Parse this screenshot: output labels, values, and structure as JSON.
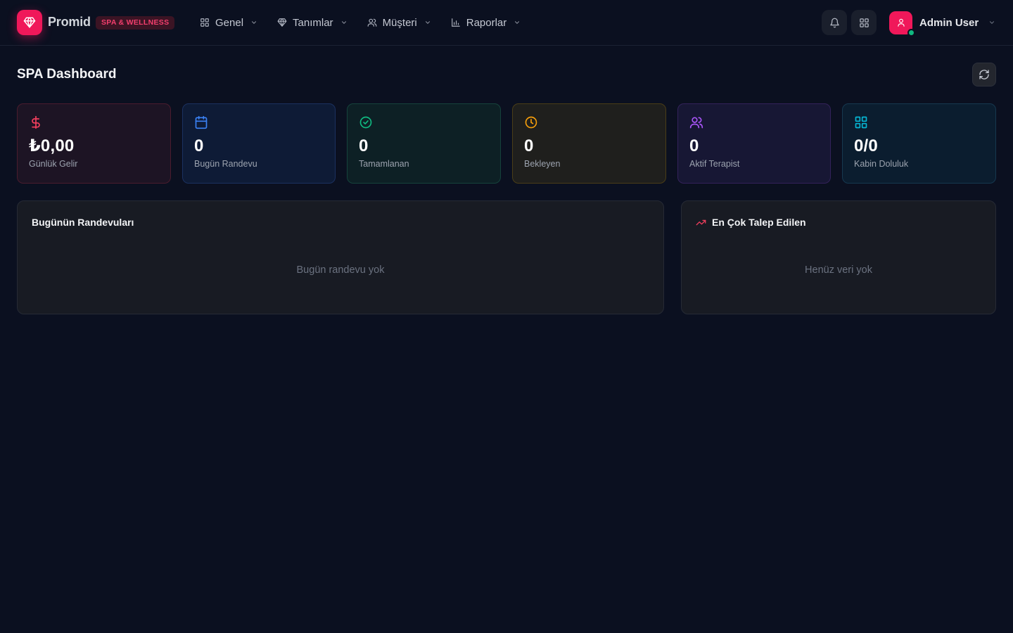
{
  "brand": {
    "name": "Promid",
    "badge": "SPA & WELLNESS",
    "accent": "#f0185a"
  },
  "nav": [
    {
      "label": "Genel",
      "icon": "grid-icon"
    },
    {
      "label": "Tanımlar",
      "icon": "gem-icon"
    },
    {
      "label": "Müşteri",
      "icon": "users-icon"
    },
    {
      "label": "Raporlar",
      "icon": "bar-chart-icon"
    }
  ],
  "header_actions": {
    "notifications_icon": "bell-icon",
    "apps_icon": "apps-grid-icon"
  },
  "user": {
    "name": "Admin User",
    "status_color": "#10b981"
  },
  "page": {
    "title": "SPA Dashboard",
    "refresh_icon": "refresh-icon"
  },
  "stats": [
    {
      "value": "₺0,00",
      "label": "Günlük Gelir",
      "icon": "dollar-icon",
      "color": "#f43f5e"
    },
    {
      "value": "0",
      "label": "Bugün Randevu",
      "icon": "calendar-icon",
      "color": "#3b82f6"
    },
    {
      "value": "0",
      "label": "Tamamlanan",
      "icon": "check-circle-icon",
      "color": "#10b981"
    },
    {
      "value": "0",
      "label": "Bekleyen",
      "icon": "clock-icon",
      "color": "#f59e0b"
    },
    {
      "value": "0",
      "label": "Aktif Terapist",
      "icon": "users-icon",
      "color": "#a855f7"
    },
    {
      "value": "0/0",
      "label": "Kabin Doluluk",
      "icon": "grid-icon",
      "color": "#06b6d4"
    }
  ],
  "panels": {
    "appointments": {
      "title": "Bugünün Randevuları",
      "empty": "Bugün randevu yok"
    },
    "popular": {
      "title": "En Çok Talep Edilen",
      "icon": "trending-up-icon",
      "empty": "Henüz veri yok"
    }
  }
}
